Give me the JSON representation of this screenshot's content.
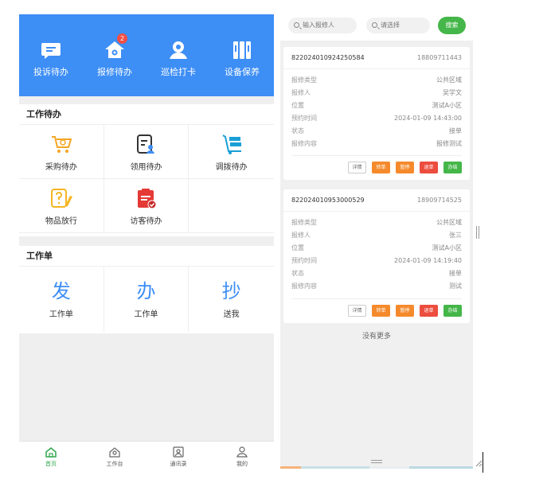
{
  "left": {
    "quick_actions": [
      {
        "label": "投诉待办",
        "icon": "chat-icon",
        "badge": ""
      },
      {
        "label": "报修待办",
        "icon": "house-repair-icon",
        "badge": "2"
      },
      {
        "label": "巡检打卡",
        "icon": "patrol-user-icon",
        "badge": ""
      },
      {
        "label": "设备保养",
        "icon": "equipment-icon",
        "badge": ""
      }
    ],
    "work_todo": {
      "title": "工作待办",
      "items": [
        {
          "label": "采购待办",
          "icon": "cart-icon"
        },
        {
          "label": "领用待办",
          "icon": "receive-icon"
        },
        {
          "label": "调拨待办",
          "icon": "transfer-icon"
        },
        {
          "label": "物品放行",
          "icon": "item-release-icon"
        },
        {
          "label": "访客待办",
          "icon": "visitor-clipboard-icon"
        }
      ]
    },
    "work_orders": {
      "title": "工作单",
      "items": [
        {
          "char": "发",
          "label": "工作单"
        },
        {
          "char": "办",
          "label": "工作单"
        },
        {
          "char": "抄",
          "label": "送我"
        }
      ]
    },
    "tabbar": [
      {
        "label": "首页",
        "icon": "home-icon",
        "active": true
      },
      {
        "label": "工作台",
        "icon": "workbench-icon",
        "active": false
      },
      {
        "label": "通讯录",
        "icon": "contacts-icon",
        "active": false
      },
      {
        "label": "我的",
        "icon": "profile-icon",
        "active": false
      }
    ]
  },
  "right": {
    "search": {
      "reporter_placeholder": "输入报修人",
      "select_placeholder": "请选择",
      "button_label": "搜索"
    },
    "cards": [
      {
        "order_no": "822024010924250584",
        "phone": "18809711443",
        "rows": [
          {
            "label": "报修类型",
            "value": "公共区域"
          },
          {
            "label": "报修人",
            "value": "吴学文"
          },
          {
            "label": "位置",
            "value": "测试A小区"
          },
          {
            "label": "预约时间",
            "value": "2024-01-09 14:43:00"
          },
          {
            "label": "状态",
            "value": "接单"
          },
          {
            "label": "报修内容",
            "value": "报修测试"
          }
        ],
        "actions": [
          {
            "label": "详情",
            "style": "detail"
          },
          {
            "label": "转单",
            "style": "orange"
          },
          {
            "label": "暂停",
            "style": "orange"
          },
          {
            "label": "退单",
            "style": "red"
          },
          {
            "label": "办结",
            "style": "green"
          }
        ]
      },
      {
        "order_no": "822024010953000529",
        "phone": "18909714525",
        "rows": [
          {
            "label": "报修类型",
            "value": "公共区域"
          },
          {
            "label": "报修人",
            "value": "张三"
          },
          {
            "label": "位置",
            "value": "测试A小区"
          },
          {
            "label": "预约时间",
            "value": "2024-01-09 14:19:40"
          },
          {
            "label": "状态",
            "value": "接单"
          },
          {
            "label": "报修内容",
            "value": "测试"
          }
        ],
        "actions": [
          {
            "label": "详情",
            "style": "detail"
          },
          {
            "label": "转单",
            "style": "orange"
          },
          {
            "label": "暂停",
            "style": "orange"
          },
          {
            "label": "退单",
            "style": "red"
          },
          {
            "label": "办结",
            "style": "green"
          }
        ]
      }
    ],
    "no_more": "没有更多"
  },
  "colors": {
    "primary_blue": "#3d8ef5",
    "green": "#45b649",
    "orange": "#f58a2c",
    "red": "#ec4d3e",
    "badge_red": "#f04f45"
  }
}
